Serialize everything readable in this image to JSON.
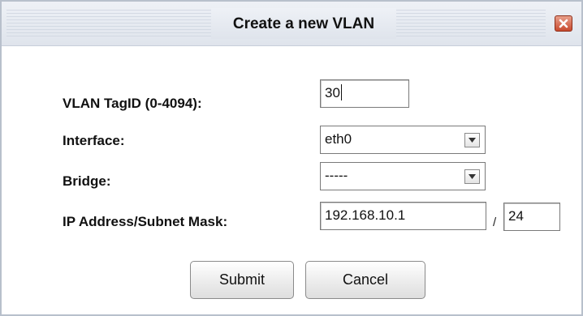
{
  "dialog": {
    "title": "Create a new VLAN",
    "close_icon": "close-x-icon"
  },
  "form": {
    "vlan_tag_label": "VLAN TagID (0-4094):",
    "vlan_tag_value": "30",
    "interface_label": "Interface:",
    "interface_value": "eth0",
    "bridge_label": "Bridge:",
    "bridge_value": "-----",
    "ip_label": "IP Address/Subnet Mask:",
    "ip_value": "192.168.10.1",
    "ip_separator": "/",
    "mask_value": "24"
  },
  "buttons": {
    "submit_label": "Submit",
    "cancel_label": "Cancel"
  },
  "colors": {
    "close_button": "#c84a2e",
    "titlebar": "#dfe4ec"
  }
}
